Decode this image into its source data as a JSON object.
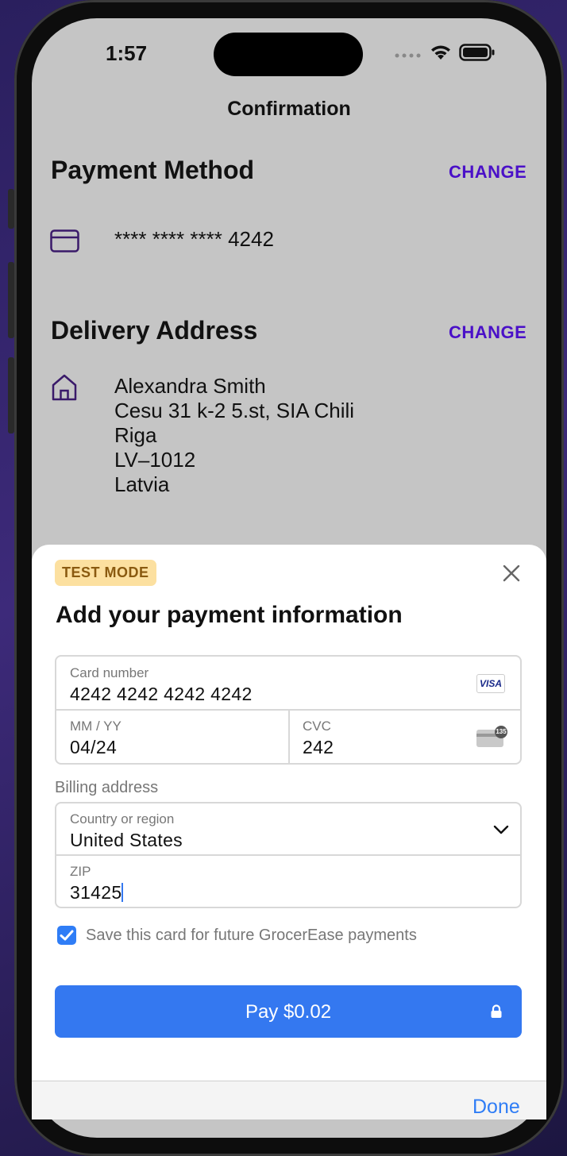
{
  "status_bar": {
    "time": "1:57"
  },
  "nav": {
    "title": "Confirmation"
  },
  "payment_method": {
    "title": "Payment Method",
    "change_label": "CHANGE",
    "card_masked": "**** **** **** 4242"
  },
  "delivery_address": {
    "title": "Delivery Address",
    "change_label": "CHANGE",
    "lines": [
      "Alexandra Smith",
      "Cesu 31 k-2 5.st, SIA Chili",
      "Riga",
      "LV–1012",
      "Latvia"
    ]
  },
  "sheet": {
    "badge": "TEST MODE",
    "title": "Add your payment information",
    "card_number": {
      "label": "Card number",
      "value": "4242 4242 4242 4242",
      "brand": "VISA"
    },
    "expiry": {
      "label": "MM / YY",
      "value": "04/24"
    },
    "cvc": {
      "label": "CVC",
      "value": "242",
      "hint": "135"
    },
    "billing_label": "Billing address",
    "country": {
      "label": "Country or region",
      "value": "United States"
    },
    "zip": {
      "label": "ZIP",
      "value": "31425"
    },
    "save_card": {
      "checked": true,
      "label": "Save this card for future GrocerEase payments"
    },
    "pay_button": {
      "label": "Pay $0.02"
    }
  },
  "toolbar": {
    "done_label": "Done"
  },
  "colors": {
    "accent_purple": "#4a10c8",
    "stripe_blue": "#3478f0",
    "badge_bg": "#fce0a0"
  }
}
